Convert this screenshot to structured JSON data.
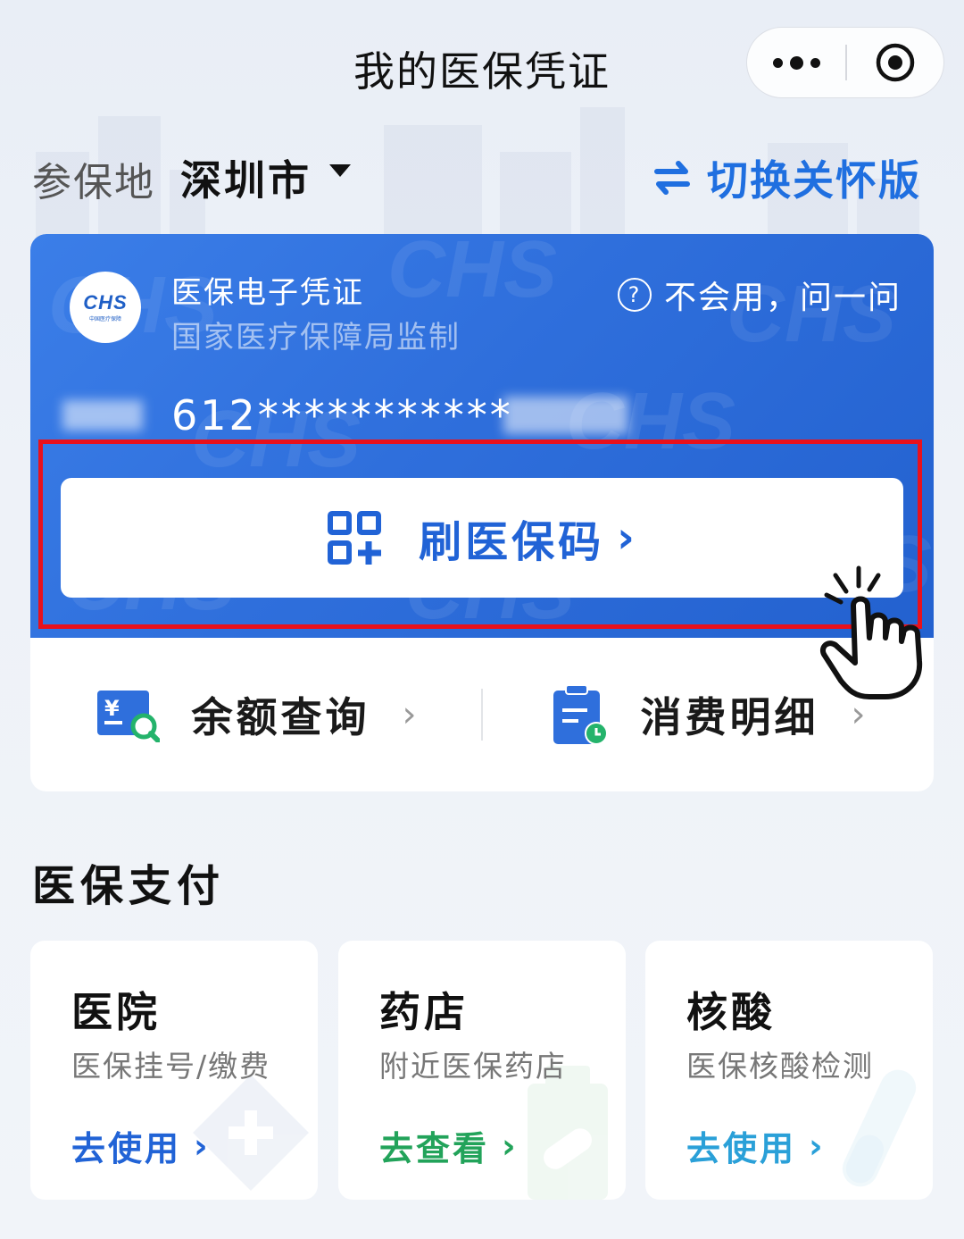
{
  "header": {
    "title": "我的医保凭证",
    "more_icon": "more-dots-icon",
    "close_icon": "target-close-icon"
  },
  "location": {
    "label": "参保地",
    "city": "深圳市",
    "switch_label": "切换关怀版"
  },
  "card": {
    "logo_text": "CHS",
    "logo_sub": "中国医疗保障",
    "title": "医保电子凭证",
    "subtitle": "国家医疗保障局监制",
    "help_label": "不会用，问一问",
    "number": "612***********",
    "qr_button_label": "刷医保码"
  },
  "quick_links": [
    {
      "label": "余额查询",
      "icon": "balance-query-icon"
    },
    {
      "label": "消费明细",
      "icon": "consumption-detail-icon"
    }
  ],
  "payment_section": {
    "title": "医保支付",
    "tiles": [
      {
        "title": "医院",
        "subtitle": "医保挂号/缴费",
        "link": "去使用",
        "link_color": "#2163d6"
      },
      {
        "title": "药店",
        "subtitle": "附近医保药店",
        "link": "去查看",
        "link_color": "#22a35a"
      },
      {
        "title": "核酸",
        "subtitle": "医保核酸检测",
        "link": "去使用",
        "link_color": "#2aa0d8"
      }
    ]
  },
  "colors": {
    "accent": "#2163d6",
    "highlight": "#e8111c"
  }
}
